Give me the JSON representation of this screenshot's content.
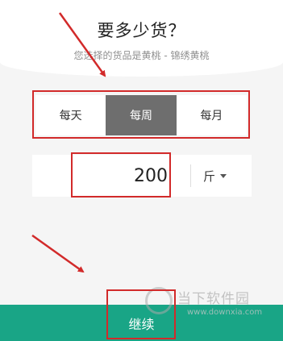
{
  "header": {
    "title": "要多少货？",
    "subtitle": "您选择的货品是黄桃 - 锦绣黄桃"
  },
  "frequency": {
    "options": [
      "每天",
      "每周",
      "每月"
    ],
    "selected": "每周"
  },
  "quantity": {
    "value": "200",
    "unit": "斤"
  },
  "footer": {
    "continue_label": "继续"
  },
  "watermark": {
    "text": "当下软件园",
    "url": "www.downxia.com"
  },
  "colors": {
    "accent": "#19a586",
    "selected_tab": "#6e6e6e",
    "annotation": "#d22a2a"
  }
}
